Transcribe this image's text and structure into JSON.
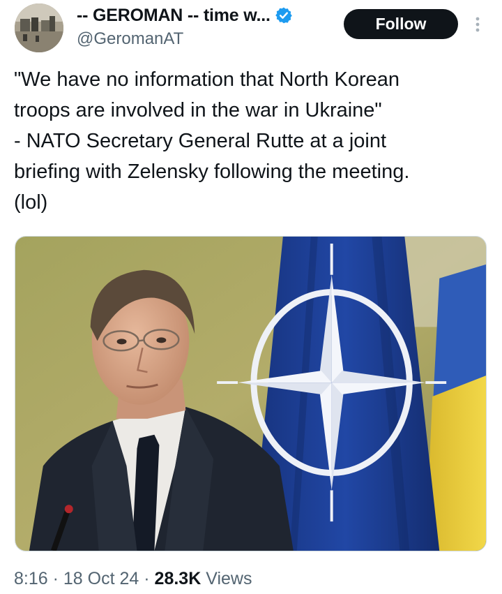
{
  "author": {
    "display_name": "-- GEROMAN -- time w...",
    "handle": "@GeromanAT",
    "verified": true,
    "avatar_icon": "profile-avatar-photo"
  },
  "actions": {
    "follow_label": "Follow",
    "more_icon": "more-vertical-icon"
  },
  "tweet": {
    "text": "\"We have no information that North Korean\ntroops are involved in the war in Ukraine\"\n- NATO Secretary General Rutte at a joint\nbriefing with Zelensky following the meeting.\n(lol)"
  },
  "media": {
    "type": "photo",
    "content": "man in dark suit in front of NATO flag and Ukrainian flag"
  },
  "meta": {
    "time": "8:16",
    "separator": "·",
    "date": "18 Oct 24",
    "views_count": "28.3K",
    "views_label": "Views"
  },
  "colors": {
    "text_primary": "#0f1419",
    "text_secondary": "#536471",
    "verified_blue": "#1d9bf0",
    "follow_bg": "#0f1419",
    "nato_blue": "#1c3f95",
    "ukraine_yellow": "#f3d23a"
  }
}
